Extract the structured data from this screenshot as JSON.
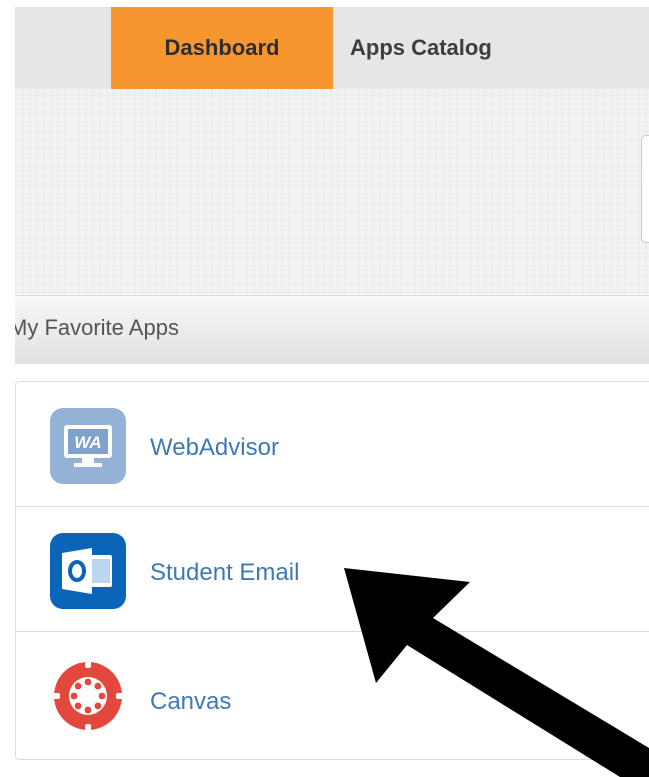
{
  "nav": {
    "tabs": [
      {
        "label": "Dashboard",
        "active": true
      },
      {
        "label": "Apps Catalog",
        "active": false
      }
    ],
    "active_color": "#f7962f",
    "bar_color": "#e6e6e6"
  },
  "favorites": {
    "title": "My Favorite Apps",
    "apps": [
      {
        "label": "WebAdvisor",
        "icon": "webadvisor-icon"
      },
      {
        "label": "Student Email",
        "icon": "outlook-icon"
      },
      {
        "label": "Canvas",
        "icon": "canvas-icon"
      }
    ],
    "link_color": "#3f79b5"
  },
  "annotation": {
    "icon": "black-arrow-pointer",
    "color": "#000000"
  }
}
